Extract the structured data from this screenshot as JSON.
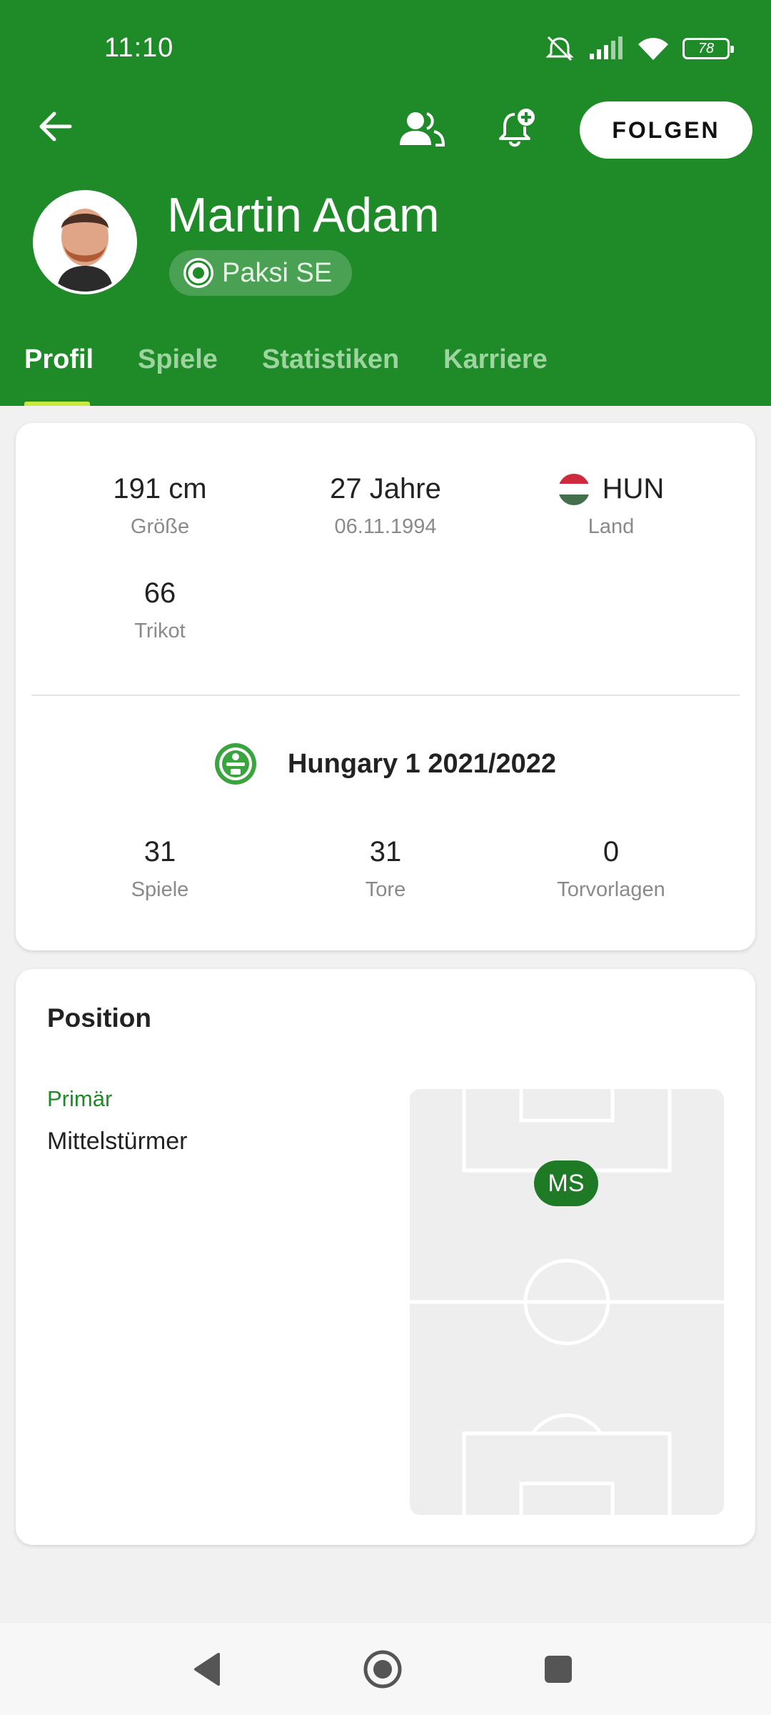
{
  "status_bar": {
    "time": "11:10",
    "battery": "78"
  },
  "header": {
    "follow_label": "FOLGEN",
    "player_name": "Martin Adam",
    "team_name": "Paksi SE",
    "accent_color": "#1f8a28"
  },
  "tabs": [
    {
      "label": "Profil",
      "active": true
    },
    {
      "label": "Spiele",
      "active": false
    },
    {
      "label": "Statistiken",
      "active": false
    },
    {
      "label": "Karriere",
      "active": false
    }
  ],
  "profile": {
    "height": {
      "value": "191 cm",
      "label": "Größe"
    },
    "age": {
      "value": "27 Jahre",
      "label": "06.11.1994"
    },
    "country": {
      "value": "HUN",
      "label": "Land",
      "flag_colors": [
        "#cd2a3e",
        "#ffffff",
        "#436f4d"
      ]
    },
    "shirt": {
      "value": "66",
      "label": "Trikot"
    }
  },
  "season": {
    "league": "Hungary 1 2021/2022",
    "stats": [
      {
        "value": "31",
        "label": "Spiele"
      },
      {
        "value": "31",
        "label": "Tore"
      },
      {
        "value": "0",
        "label": "Torvorlagen"
      }
    ]
  },
  "position": {
    "title": "Position",
    "primary_label": "Primär",
    "primary_value": "Mittelstürmer",
    "marker": "MS"
  },
  "icons": [
    "arrow-back-icon",
    "people-icon",
    "bell-add-icon",
    "nav-back-icon",
    "nav-home-icon",
    "nav-recents-icon"
  ]
}
